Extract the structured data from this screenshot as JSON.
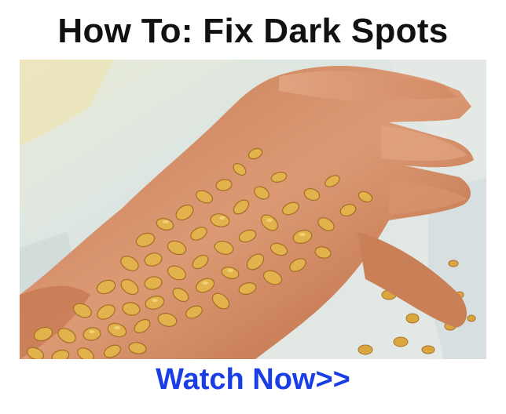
{
  "ad": {
    "headline": "How To: Fix Dark Spots",
    "cta_label": "Watch Now>>",
    "illustration": "watercolor-hand-holding-oats",
    "colors": {
      "headline": "#111111",
      "cta": "#1a3ee6",
      "skin": "#d9906c",
      "oats": "#e0b04a",
      "background_wash": "#dfe6e2"
    }
  }
}
